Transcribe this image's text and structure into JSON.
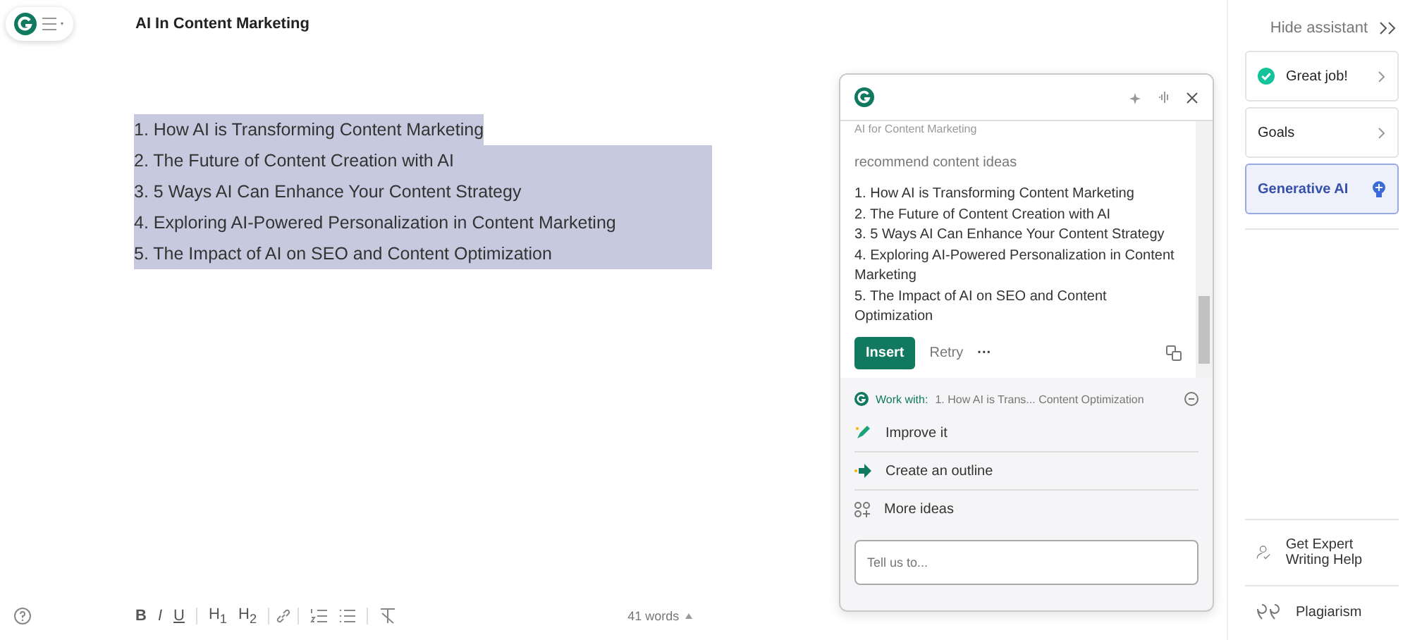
{
  "document": {
    "title": "AI In Content Marketing",
    "lines": [
      {
        "text": "1. How AI is Transforming Content Marketing",
        "selected": true
      },
      {
        "text": "2. The Future of Content Creation with AI",
        "selected": true
      },
      {
        "text": "3. 5 Ways AI Can Enhance Your Content Strategy",
        "selected": true
      },
      {
        "text": "4. Exploring AI-Powered Personalization in Content Marketing",
        "selected": true
      },
      {
        "text": "5. The Impact of AI on SEO and Content Optimization",
        "selected": true
      }
    ]
  },
  "toolbar": {
    "format_buttons": [
      "B",
      "I",
      "U",
      "H$_{1}$",
      "H$_{2}$"
    ],
    "word_count": "41 words"
  },
  "assistant_popup": {
    "context": "AI for Content Marketing",
    "prompt": "recommend content ideas",
    "result_lines": [
      "1. How AI is Transforming Content Marketing",
      "2. The Future of Content Creation with AI",
      "3. 5 Ways AI Can Enhance Your Content Strategy",
      "4. Exploring AI-Powered Personalization in Content Marketing",
      "5. The Impact of AI on SEO and Content Optimization"
    ],
    "insert": "Insert",
    "retry": "Retry",
    "more": "···",
    "work_with_label": "Work with:",
    "work_with_text": "1. How AI is Trans... Content Optimization",
    "actions": [
      {
        "kind": "improve",
        "label": "Improve it"
      },
      {
        "kind": "outline",
        "label": "Create an outline"
      },
      {
        "kind": "ideas",
        "label": "More ideas"
      }
    ],
    "input_placeholder": "Tell us to..."
  },
  "sidebar": {
    "hide": "Hide assistant",
    "cards": [
      {
        "kind": "check",
        "label": "Great job!",
        "selected": false
      },
      {
        "kind": "chevron",
        "label": "Goals",
        "selected": false
      },
      {
        "kind": "bulb",
        "label": "Generative AI",
        "selected": true
      }
    ],
    "bottom": [
      {
        "kind": "expert",
        "label": "Get Expert Writing Help"
      },
      {
        "kind": "quote",
        "label": "Plagiarism"
      }
    ]
  }
}
